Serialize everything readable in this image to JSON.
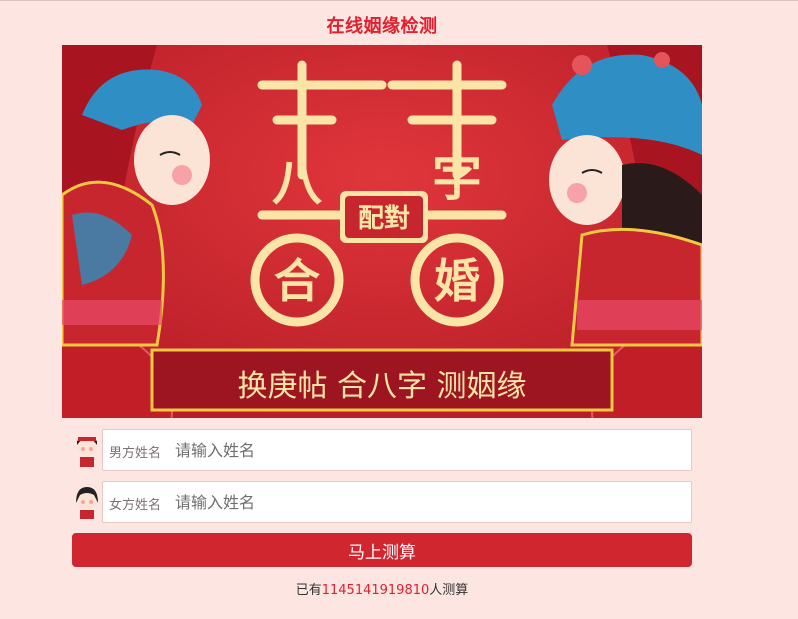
{
  "page": {
    "title": "在线姻缘检测"
  },
  "banner": {
    "heading_left": "吉",
    "heading_right": "吉",
    "char_ba": "八",
    "char_zi": "字",
    "char_he": "合",
    "char_hun": "婚",
    "badge": "配對",
    "slogan": "换庚帖 合八字 测姻缘"
  },
  "form": {
    "male": {
      "label": "男方姓名",
      "placeholder": "请输入姓名",
      "value": ""
    },
    "female": {
      "label": "女方姓名",
      "placeholder": "请输入姓名",
      "value": ""
    },
    "submit_label": "马上测算"
  },
  "stats": {
    "prefix": "已有",
    "count": "1145141919810",
    "suffix": "人测算"
  },
  "colors": {
    "accent": "#d0262f",
    "background": "#fde5e2",
    "title": "#e0202f",
    "banner_gold": "#fbe5a6"
  }
}
